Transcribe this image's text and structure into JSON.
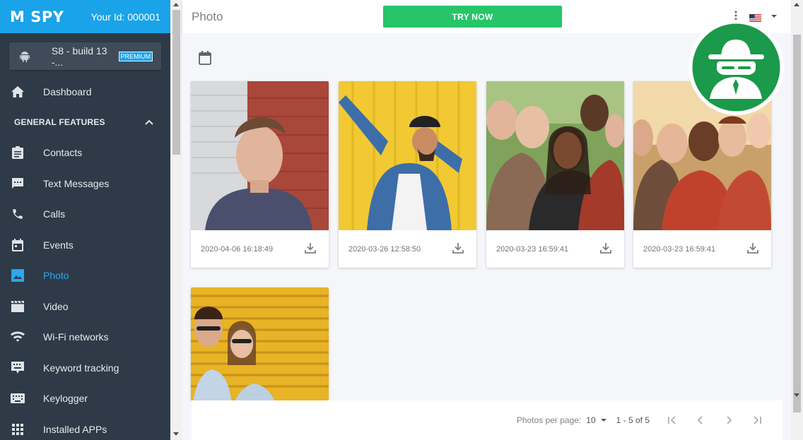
{
  "brand": {
    "logo": "M SPY",
    "user_id": "Your Id: 000001"
  },
  "device": {
    "name": "S8 - build 13 -...",
    "badge": "PREMIUM"
  },
  "sidebar": {
    "top_item": {
      "label": "Dashboard",
      "icon": "home-icon"
    },
    "section": {
      "label": "GENERAL FEATURES",
      "icon": "chevron-up-icon"
    },
    "items": [
      {
        "label": "Contacts",
        "icon": "clipboard-icon"
      },
      {
        "label": "Text Messages",
        "icon": "message-icon"
      },
      {
        "label": "Calls",
        "icon": "phone-icon"
      },
      {
        "label": "Events",
        "icon": "calendar-icon"
      },
      {
        "label": "Photo",
        "icon": "image-icon",
        "active": true
      },
      {
        "label": "Video",
        "icon": "film-icon"
      },
      {
        "label": "Wi-Fi networks",
        "icon": "wifi-icon"
      },
      {
        "label": "Keyword tracking",
        "icon": "keyword-icon"
      },
      {
        "label": "Keylogger",
        "icon": "keyboard-icon"
      },
      {
        "label": "Installed APPs",
        "icon": "apps-icon"
      }
    ]
  },
  "header": {
    "title": "Photo",
    "try_now": "TRY NOW"
  },
  "photos": [
    {
      "timestamp": "2020-04-06 16:18:49"
    },
    {
      "timestamp": "2020-03-26 12:58:50"
    },
    {
      "timestamp": "2020-03-23 16:59:41"
    },
    {
      "timestamp": "2020-03-23 16:59:41"
    },
    {
      "timestamp": ""
    }
  ],
  "pager": {
    "label": "Photos per page:",
    "per_page": "10",
    "range": "1 - 5 of 5"
  },
  "colors": {
    "brand": "#1aa3e8",
    "sidebar": "#2e3a47",
    "accent_green": "#27c46a",
    "active": "#29a8ec"
  }
}
